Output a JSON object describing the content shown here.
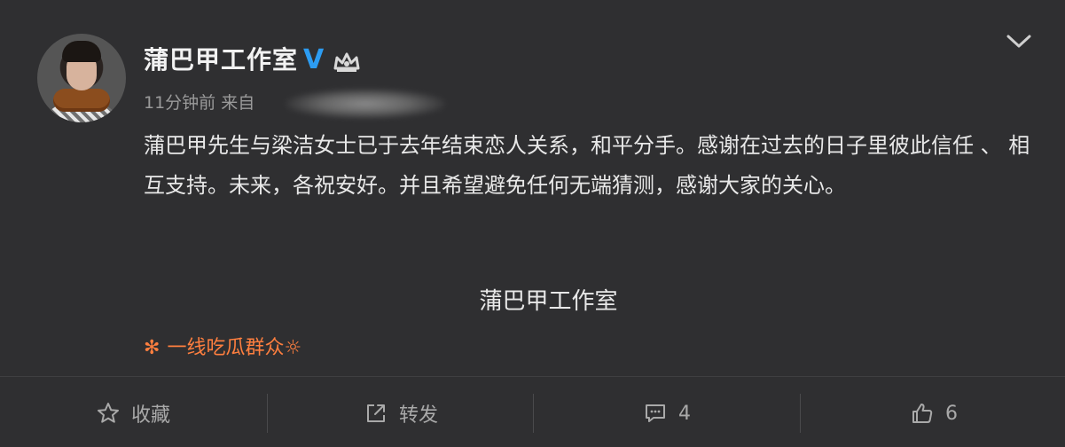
{
  "header": {
    "username": "蒲巴甲工作室",
    "verified_badge": "V",
    "time": "11分钟前",
    "from_label": "来自"
  },
  "post": {
    "body": "蒲巴甲先生与梁洁女士已于去年结束恋人关系，和平分手。感谢在过去的日子里彼此信任 、 相互支持。未来，各祝安好。并且希望避免任何无端猜测，感谢大家的关心。",
    "signature": "蒲巴甲工作室"
  },
  "source": {
    "flower": "✻",
    "text": "一线吃瓜群众☼"
  },
  "actions": {
    "favorite_label": "收藏",
    "forward_label": "转发",
    "comment_count": "4",
    "like_count": "6"
  },
  "colors": {
    "background": "#2f2f31",
    "verified": "#2c9cf2",
    "source": "#ff7f3f",
    "text": "#e8e8e8",
    "muted": "#9a9a9a"
  }
}
